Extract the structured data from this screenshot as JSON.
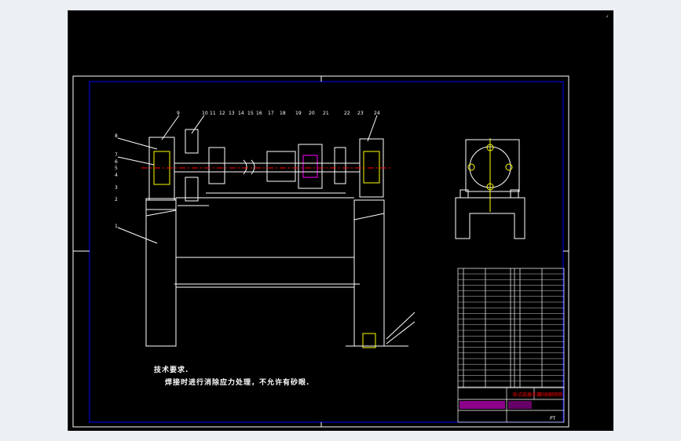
{
  "notes": {
    "title": "技术要求.",
    "line1": "焊接时进行消除应力处理，不允许有砂眼."
  },
  "part_numbers": [
    "9",
    "10",
    "11",
    "12",
    "13",
    "14",
    "15",
    "16",
    "17",
    "18",
    "19",
    "20",
    "21",
    "22",
    "23",
    "24"
  ],
  "left_labels": [
    "8",
    "7",
    "6",
    "5",
    "4",
    "3",
    "2",
    "1"
  ],
  "title_block": {
    "drawing_name": "卧式纸器手架",
    "company": "中国钢铁网",
    "mark": "PT"
  },
  "colors": {
    "canvas": "#000000",
    "frame": "#0000ff",
    "border": "#ffffff",
    "geometry": "#ffffff",
    "accent_yellow": "#ffff00",
    "accent_red": "#ff0000",
    "accent_magenta": "#ff00ff",
    "accent_cyan": "#00ffff",
    "accent_green": "#00ff00"
  }
}
